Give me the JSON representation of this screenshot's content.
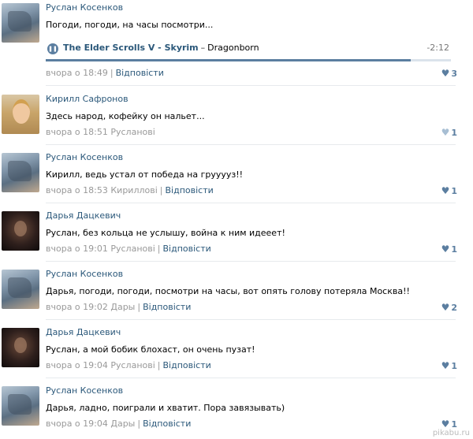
{
  "comments": [
    {
      "author": "Руслан Косенков",
      "text": "Погоди, погоди, на часы посмотри...",
      "time": "вчора о 18:49",
      "addressee": "",
      "reply": "Відповісти",
      "likes": "3",
      "avatar": "ruslan",
      "audio": {
        "artist": "The Elder Scrolls V - Skyrim",
        "dash": "–",
        "title": "Dragonborn",
        "duration": "-2:12",
        "progress": 0.9,
        "play_icon": "pause-icon"
      }
    },
    {
      "author": "Кирилл Сафронов",
      "text": "Здесь народ, кофейку он нальет...",
      "time": "вчора о 18:51",
      "addressee": "Русланові",
      "reply": "",
      "likes": "1",
      "avatar": "kirill"
    },
    {
      "author": "Руслан Косенков",
      "text": "Кирилл, ведь устал от победа на грууууз!!",
      "time": "вчора о 18:53",
      "addressee": "Кириллові",
      "reply": "Відповісти",
      "likes": "1",
      "avatar": "ruslan"
    },
    {
      "author": "Дарья Дацкевич",
      "text": "Руслан, без кольца не услышу, война к ним идееет!",
      "time": "вчора о 19:01",
      "addressee": "Русланові",
      "reply": "Відповісти",
      "likes": "1",
      "avatar": "darya"
    },
    {
      "author": "Руслан Косенков",
      "text": "Дарья, погоди, погоди, посмотри на часы, вот опять голову потеряла Москва!!",
      "time": "вчора о 19:02",
      "addressee": "Дары",
      "reply": "Відповісти",
      "likes": "2",
      "avatar": "ruslan"
    },
    {
      "author": "Дарья Дацкевич",
      "text": "Руслан, а мой бобик блохаст, он очень пузат!",
      "time": "вчора о 19:04",
      "addressee": "Русланові",
      "reply": "Відповісти",
      "likes": "1",
      "avatar": "darya"
    },
    {
      "author": "Руслан Косенков",
      "text": "Дарья, ладно, поиграли и хватит. Пора завязывать)",
      "time": "вчора о 19:04",
      "addressee": "Дары",
      "reply": "Відповісти",
      "likes": "1",
      "avatar": "ruslan"
    }
  ],
  "separator": "|",
  "heart_icon": "heart-icon",
  "colors": {
    "link": "#2b587a",
    "meta": "#999999",
    "like": "#5b7ea0",
    "divider": "#e7eaed"
  },
  "watermark": "pikabu.ru"
}
